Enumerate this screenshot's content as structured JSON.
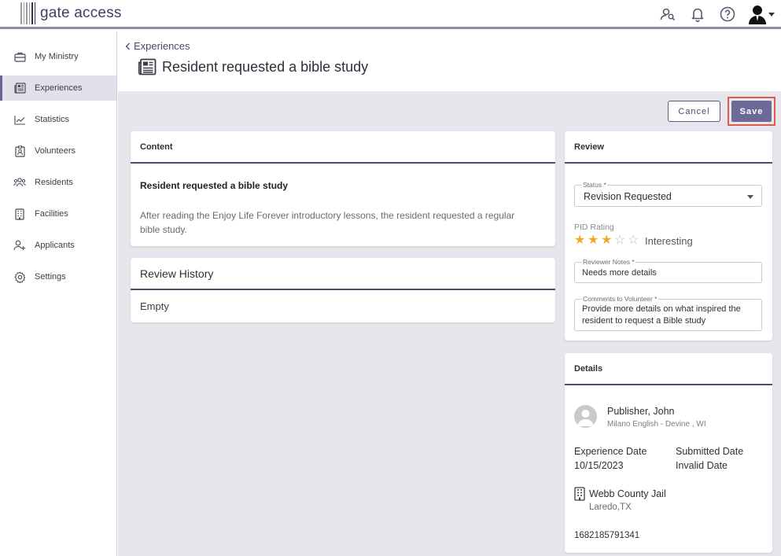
{
  "app": {
    "logo_text": "gate access"
  },
  "topbar": {
    "icons": [
      "people-search-icon",
      "bell-icon",
      "help-icon",
      "user-avatar-icon"
    ]
  },
  "sidebar": {
    "items": [
      {
        "label": "My Ministry",
        "icon": "briefcase-icon",
        "active": false
      },
      {
        "label": "Experiences",
        "icon": "newspaper-icon",
        "active": true
      },
      {
        "label": "Statistics",
        "icon": "trend-chart-icon",
        "active": false
      },
      {
        "label": "Volunteers",
        "icon": "badge-icon",
        "active": false
      },
      {
        "label": "Residents",
        "icon": "group-icon",
        "active": false
      },
      {
        "label": "Facilities",
        "icon": "building-icon",
        "active": false
      },
      {
        "label": "Applicants",
        "icon": "person-add-icon",
        "active": false
      },
      {
        "label": "Settings",
        "icon": "gear-icon",
        "active": false
      }
    ]
  },
  "header": {
    "breadcrumb": "Experiences",
    "title": "Resident requested a bible study"
  },
  "actions": {
    "cancel_label": "Cancel",
    "save_label": "Save"
  },
  "content": {
    "heading": "Content",
    "title": "Resident requested a bible study",
    "body": "After reading the Enjoy Life Forever introductory lessons, the resident requested a regular bible study."
  },
  "history": {
    "heading": "Review History",
    "empty_text": "Empty"
  },
  "review": {
    "heading": "Review",
    "status_label": "Status *",
    "status_value": "Revision Requested",
    "pid_label": "PID Rating",
    "rating": 3,
    "rating_max": 5,
    "rating_text": "Interesting",
    "notes_label": "Reviewer Notes *",
    "notes_value": "Needs more details",
    "comments_label": "Comments to Volunteer *",
    "comments_value": "Provide more details on what inspired the resident to request a Bible study"
  },
  "details": {
    "heading": "Details",
    "publisher_name": "Publisher, John",
    "publisher_sub": "Milano English - Devine , WI",
    "experience_date_label": "Experience Date",
    "experience_date": "10/15/2023",
    "submitted_date_label": "Submitted Date",
    "submitted_date": "Invalid Date",
    "facility_name": "Webb County Jail",
    "facility_location": "Laredo,TX",
    "id": "1682185791341"
  },
  "colors": {
    "accent": "#6c6a96",
    "highlight_border": "#e05a4a",
    "star": "#f0a82a",
    "main_bg": "#e6e6ec"
  }
}
